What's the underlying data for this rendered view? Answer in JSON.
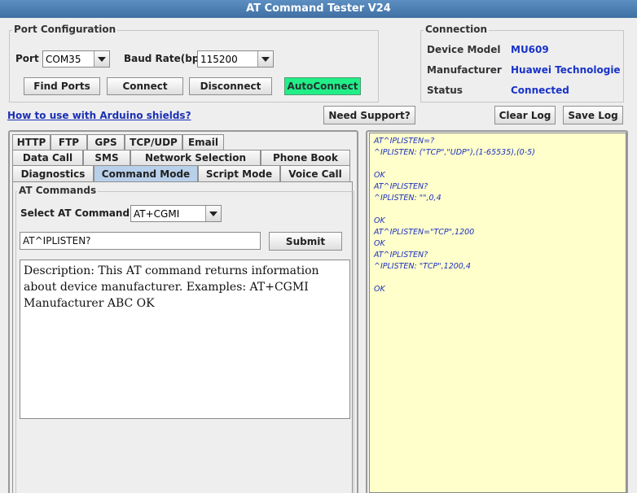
{
  "window": {
    "title": "AT Command Tester V24"
  },
  "port_config": {
    "title": "Port Configuration",
    "port_label": "Port",
    "port_value": "COM35",
    "baud_label": "Baud Rate(bps)",
    "baud_value": "115200",
    "buttons": {
      "find_ports": "Find Ports",
      "connect": "Connect",
      "disconnect": "Disconnect",
      "autoconnect": "AutoConnect"
    }
  },
  "connection": {
    "title": "Connection",
    "rows": [
      {
        "key": "Device Model",
        "value": "MU609"
      },
      {
        "key": "Manufacturer",
        "value": "Huawei Technologie..."
      },
      {
        "key": "Status",
        "value": "Connected"
      }
    ]
  },
  "toolbar": {
    "help_link": "How to use with Arduino shields?",
    "need_support": "Need Support?",
    "clear_log": "Clear Log",
    "save_log": "Save Log"
  },
  "tabs": {
    "row1": [
      "HTTP",
      "FTP",
      "GPS",
      "TCP/UDP",
      "Email"
    ],
    "row2": [
      "Data Call",
      "SMS",
      "Network Selection",
      "Phone Book"
    ],
    "row3": [
      "Diagnostics",
      "Command Mode",
      "Script Mode",
      "Voice Call"
    ],
    "active": "Command Mode"
  },
  "at_commands": {
    "title": "AT Commands",
    "select_label": "Select AT Command",
    "select_value": "AT+CGMI",
    "input_value": "AT^IPLISTEN?",
    "submit": "Submit",
    "description": "Description: This AT command returns information about device manufacturer. Examples: AT+CGMI Manufacturer ABC OK"
  },
  "log": {
    "lines": [
      "AT^IPLISTEN=?",
      "^IPLISTEN: (\"TCP\",\"UDP\"),(1-65535),(0-5)",
      "",
      "OK",
      "AT^IPLISTEN?",
      "^IPLISTEN: \"\",0,4",
      "",
      "OK",
      "AT^IPLISTEN=\"TCP\",1200",
      "OK",
      "AT^IPLISTEN?",
      "^IPLISTEN: \"TCP\",1200,4",
      "",
      "OK"
    ]
  },
  "colors": {
    "title_bar": "#4a7db3",
    "autoconnect": "#22ee88",
    "log_bg": "#ffffcc",
    "log_text": "#1c2fbf",
    "active_tab": "#b8d0ea"
  }
}
